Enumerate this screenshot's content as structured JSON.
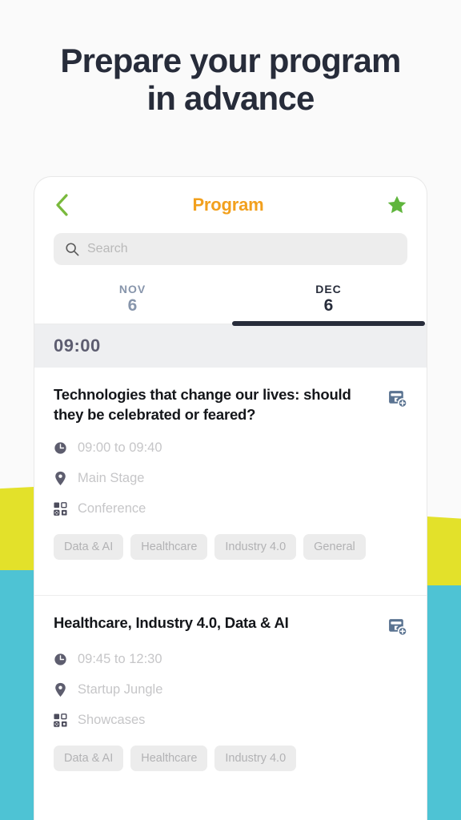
{
  "headline": {
    "line1": "Prepare your program",
    "line2": "in advance"
  },
  "colors": {
    "page_background": "#fafafa",
    "accent_orange": "#f2a01d",
    "accent_green": "#79b93c",
    "accent_navy": "#272c3a",
    "block_yellow": "#e3e12a",
    "block_cyan": "#4ec3d4",
    "calendar_icon": "#5a7391"
  },
  "phone": {
    "nav": {
      "back_icon": "chevron-left-icon",
      "title": "Program",
      "star_icon": "star-icon"
    },
    "search": {
      "icon": "search-icon",
      "placeholder": "Search",
      "value": ""
    },
    "tabs": [
      {
        "month": "NOV",
        "day": "6",
        "active": false
      },
      {
        "month": "DEC",
        "day": "6",
        "active": true
      }
    ],
    "time_group": {
      "label": "09:00"
    },
    "events": [
      {
        "title": "Technologies that change our lives: should they be celebrated or feared?",
        "add_icon": "add-to-calendar-icon",
        "time": "09:00 to 09:40",
        "time_icon": "clock-icon",
        "location": "Main Stage",
        "location_icon": "location-pin-icon",
        "category": "Conference",
        "category_icon": "grid-category-icon",
        "tags": [
          "Data & AI",
          "Healthcare",
          "Industry 4.0",
          "General"
        ]
      },
      {
        "title": "Healthcare, Industry 4.0, Data & AI",
        "add_icon": "add-to-calendar-icon",
        "time": "09:45 to 12:30",
        "time_icon": "clock-icon",
        "location": "Startup Jungle",
        "location_icon": "location-pin-icon",
        "category": "Showcases",
        "category_icon": "grid-category-icon",
        "tags": [
          "Data & AI",
          "Healthcare",
          "Industry 4.0"
        ]
      }
    ]
  }
}
